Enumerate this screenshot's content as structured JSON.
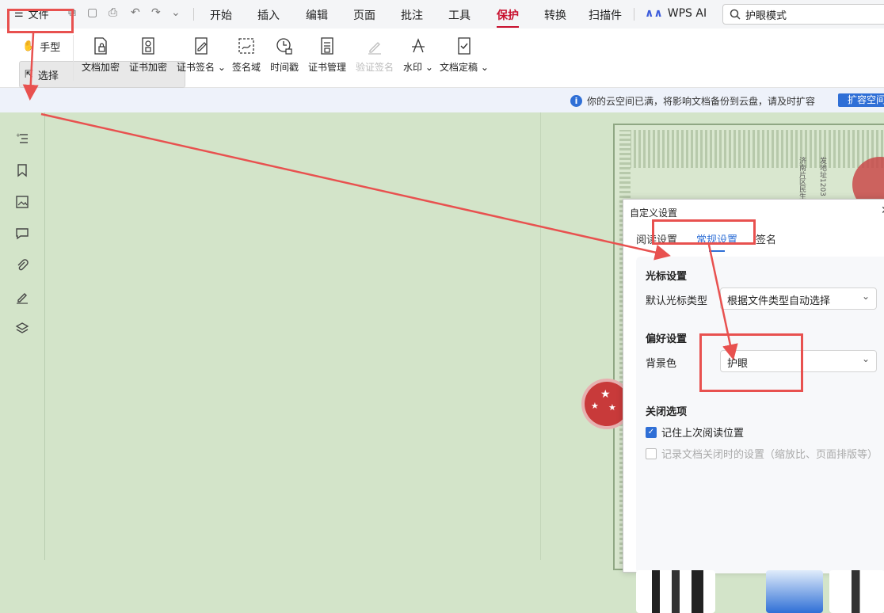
{
  "menubar": {
    "file_label": "文件",
    "tabs": [
      "开始",
      "插入",
      "编辑",
      "页面",
      "批注",
      "工具",
      "保护",
      "转换",
      "扫描件"
    ],
    "active_tab": "保护",
    "wps_ai": "WPS AI",
    "search_value": "护眼模式"
  },
  "ribbon": {
    "hand_tool": "手型",
    "select_tool": "选择",
    "items": [
      {
        "label": "文档加密",
        "icon": "doc-lock-icon"
      },
      {
        "label": "证书加密",
        "icon": "cert-lock-icon"
      },
      {
        "label": "证书签名",
        "icon": "cert-sign-icon",
        "dropdown": true
      },
      {
        "label": "签名域",
        "icon": "sign-field-icon"
      },
      {
        "label": "时间戳",
        "icon": "timestamp-icon"
      },
      {
        "label": "证书管理",
        "icon": "cert-manage-icon"
      },
      {
        "label": "验证签名",
        "icon": "verify-sign-icon",
        "disabled": true
      },
      {
        "label": "水印",
        "icon": "watermark-icon",
        "dropdown": true
      },
      {
        "label": "文档定稿",
        "icon": "finalize-icon",
        "dropdown": true
      }
    ]
  },
  "notice": {
    "text": "你的云空间已满，将影响文档备份到云盘，请及时扩容",
    "button": "扩容空间"
  },
  "sidebar": {
    "icons": [
      "outline-icon",
      "bookmark-icon",
      "image-icon",
      "comment-icon",
      "attachment-icon",
      "signature-icon",
      "layers-icon"
    ]
  },
  "certificate": {
    "text_cols": [
      "济南片区民生",
      "发地址1203"
    ]
  },
  "dialog": {
    "title": "自定义设置",
    "tabs": [
      "阅读设置",
      "常规设置",
      "签名"
    ],
    "active_tab": "常规设置",
    "cursor_section": "光标设置",
    "cursor_label": "默认光标类型",
    "cursor_value": "根据文件类型自动选择",
    "pref_section": "偏好设置",
    "bg_label": "背景色",
    "bg_value": "护眼",
    "close_section": "关闭选项",
    "check1": {
      "label": "记住上次阅读位置",
      "checked": true
    },
    "check2": {
      "label": "记录文档关闭时的设置（缩放比、页面排版等）",
      "checked": false
    }
  },
  "colors": {
    "accent": "#2f6fd6",
    "protect_tab": "#c8102e",
    "annotation": "#e8514f",
    "eye_care_bg": "#d3e4c9"
  }
}
